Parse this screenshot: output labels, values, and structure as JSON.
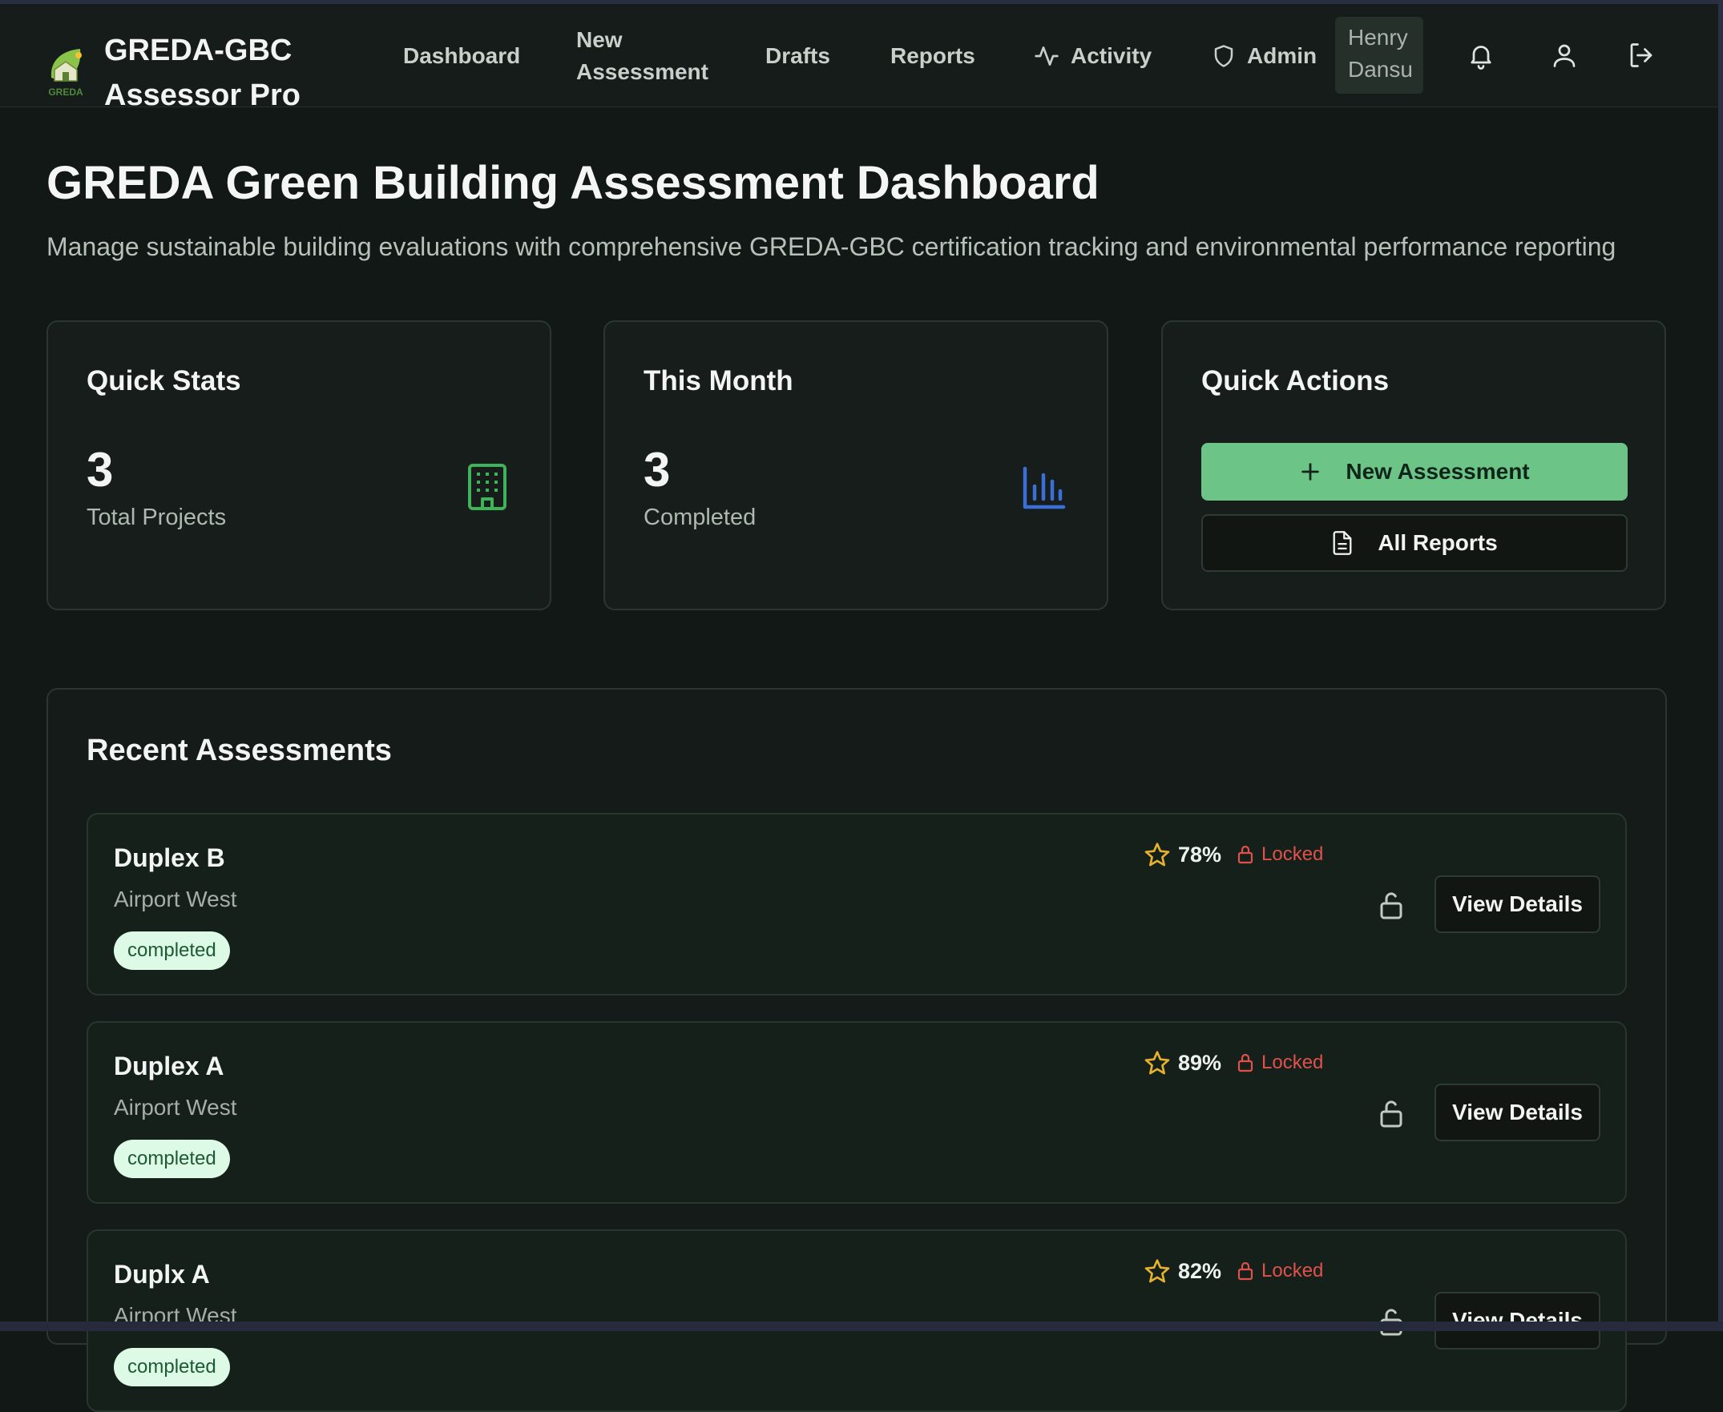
{
  "app": {
    "title_line1": "GREDA-GBC",
    "title_line2": "Assessor Pro",
    "logo_text": "GREDA"
  },
  "nav": {
    "dashboard": "Dashboard",
    "new_assessment": "New Assessment",
    "drafts": "Drafts",
    "reports": "Reports",
    "activity": "Activity",
    "admin": "Admin",
    "user_name": "Henry Dansu"
  },
  "page": {
    "title": "GREDA Green Building Assessment Dashboard",
    "subtitle": "Manage sustainable building evaluations with comprehensive GREDA-GBC certification tracking and environmental performance reporting"
  },
  "quick_stats": {
    "title": "Quick Stats",
    "value": "3",
    "label": "Total Projects",
    "icon": "building-icon"
  },
  "this_month": {
    "title": "This Month",
    "value": "3",
    "label": "Completed",
    "icon": "bar-chart-icon"
  },
  "quick_actions": {
    "title": "Quick Actions",
    "new_assessment_label": "New Assessment",
    "all_reports_label": "All Reports"
  },
  "recent": {
    "title": "Recent Assessments",
    "items": [
      {
        "name": "Duplex B",
        "location": "Airport West",
        "status": "completed",
        "score": "78%",
        "lock_status": "Locked",
        "action_label": "View Details"
      },
      {
        "name": "Duplex A",
        "location": "Airport West",
        "status": "completed",
        "score": "89%",
        "lock_status": "Locked",
        "action_label": "View Details"
      },
      {
        "name": "Duplx A",
        "location": "Airport West",
        "status": "completed",
        "score": "82%",
        "lock_status": "Locked",
        "action_label": "View Details"
      }
    ]
  },
  "colors": {
    "background": "#121815",
    "accent_green": "#6cc487",
    "locked_red": "#e0514b",
    "star_gold": "#e6b12e",
    "chart_blue": "#3b6fd8"
  }
}
